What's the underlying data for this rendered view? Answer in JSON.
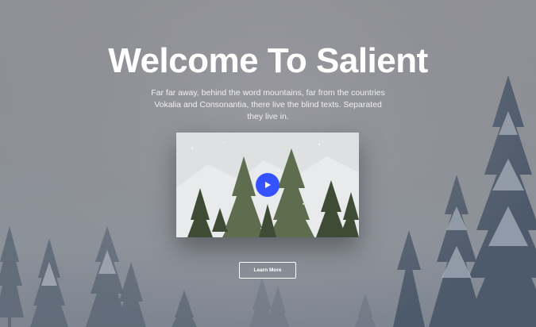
{
  "hero": {
    "title": "Welcome To Salient",
    "subtitle": "Far far away, behind the word mountains, far from the countries Vokalia and Consonantia, there live the blind texts. Separated they live in.",
    "cta_label": "Learn More"
  },
  "video": {
    "play_icon": "play-icon",
    "accent_color": "#3452ff"
  },
  "colors": {
    "title": "#ffffff",
    "text": "#f0f0f2"
  }
}
